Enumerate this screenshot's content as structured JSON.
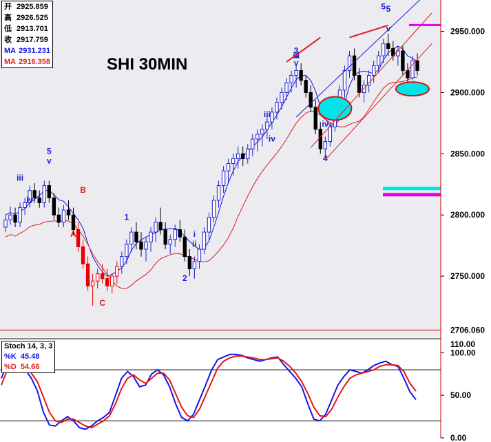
{
  "chart_data": [
    {
      "type": "candlestick",
      "title": "SHI 30MIN",
      "ohlc_box": {
        "open_label": "开",
        "open": "2925.859",
        "high_label": "高",
        "high": "2926.525",
        "low_label": "低",
        "low": "2913.701",
        "close_label": "收",
        "close": "2917.759",
        "ma1_label": "MA",
        "ma1": "2931.231",
        "ma2_label": "MA",
        "ma2": "2916.358"
      },
      "ylim": [
        2700,
        2970
      ],
      "y_ticks": [
        "2950.000",
        "2900.000",
        "2850.000",
        "2800.000",
        "2750.000"
      ],
      "last_price_label": "2706.060",
      "hline_level": 2706,
      "candles": [
        [
          2790,
          2800,
          2786,
          2796
        ],
        [
          2796,
          2807,
          2792,
          2800
        ],
        [
          2800,
          2806,
          2790,
          2794
        ],
        [
          2794,
          2810,
          2790,
          2806
        ],
        [
          2806,
          2814,
          2800,
          2810
        ],
        [
          2810,
          2824,
          2806,
          2820
        ],
        [
          2820,
          2826,
          2810,
          2814
        ],
        [
          2814,
          2820,
          2806,
          2810
        ],
        [
          2810,
          2828,
          2806,
          2824
        ],
        [
          2824,
          2828,
          2810,
          2814
        ],
        [
          2814,
          2818,
          2796,
          2800
        ],
        [
          2800,
          2806,
          2790,
          2794
        ],
        [
          2794,
          2808,
          2790,
          2804
        ],
        [
          2804,
          2812,
          2796,
          2800
        ],
        [
          2800,
          2806,
          2784,
          2788
        ],
        [
          2788,
          2794,
          2770,
          2774
        ],
        [
          2774,
          2780,
          2756,
          2760
        ],
        [
          2760,
          2766,
          2738,
          2742
        ],
        [
          2742,
          2752,
          2726,
          2746
        ],
        [
          2746,
          2756,
          2740,
          2752
        ],
        [
          2752,
          2760,
          2744,
          2748
        ],
        [
          2748,
          2756,
          2738,
          2742
        ],
        [
          2742,
          2752,
          2736,
          2750
        ],
        [
          2750,
          2762,
          2744,
          2758
        ],
        [
          2758,
          2770,
          2752,
          2766
        ],
        [
          2766,
          2780,
          2760,
          2776
        ],
        [
          2776,
          2790,
          2770,
          2786
        ],
        [
          2786,
          2794,
          2772,
          2778
        ],
        [
          2778,
          2786,
          2766,
          2772
        ],
        [
          2772,
          2782,
          2762,
          2778
        ],
        [
          2778,
          2790,
          2770,
          2786
        ],
        [
          2786,
          2798,
          2778,
          2794
        ],
        [
          2794,
          2806,
          2784,
          2788
        ],
        [
          2788,
          2794,
          2772,
          2776
        ],
        [
          2776,
          2784,
          2768,
          2780
        ],
        [
          2780,
          2792,
          2774,
          2788
        ],
        [
          2788,
          2796,
          2778,
          2782
        ],
        [
          2782,
          2788,
          2762,
          2766
        ],
        [
          2766,
          2772,
          2750,
          2756
        ],
        [
          2756,
          2766,
          2748,
          2762
        ],
        [
          2762,
          2776,
          2756,
          2772
        ],
        [
          2772,
          2790,
          2768,
          2786
        ],
        [
          2786,
          2802,
          2780,
          2798
        ],
        [
          2798,
          2816,
          2794,
          2812
        ],
        [
          2812,
          2828,
          2806,
          2824
        ],
        [
          2824,
          2840,
          2818,
          2836
        ],
        [
          2836,
          2846,
          2826,
          2842
        ],
        [
          2842,
          2850,
          2832,
          2846
        ],
        [
          2846,
          2856,
          2838,
          2850
        ],
        [
          2850,
          2856,
          2840,
          2846
        ],
        [
          2846,
          2858,
          2842,
          2854
        ],
        [
          2854,
          2866,
          2848,
          2862
        ],
        [
          2862,
          2870,
          2852,
          2866
        ],
        [
          2866,
          2874,
          2856,
          2870
        ],
        [
          2870,
          2880,
          2862,
          2876
        ],
        [
          2876,
          2888,
          2870,
          2884
        ],
        [
          2884,
          2896,
          2878,
          2892
        ],
        [
          2892,
          2904,
          2886,
          2900
        ],
        [
          2900,
          2912,
          2894,
          2908
        ],
        [
          2908,
          2918,
          2900,
          2914
        ],
        [
          2914,
          2922,
          2904,
          2918
        ],
        [
          2918,
          2924,
          2906,
          2910
        ],
        [
          2910,
          2914,
          2896,
          2900
        ],
        [
          2900,
          2906,
          2884,
          2888
        ],
        [
          2888,
          2894,
          2866,
          2870
        ],
        [
          2870,
          2876,
          2850,
          2854
        ],
        [
          2854,
          2864,
          2846,
          2860
        ],
        [
          2860,
          2876,
          2856,
          2872
        ],
        [
          2872,
          2890,
          2868,
          2886
        ],
        [
          2886,
          2906,
          2880,
          2902
        ],
        [
          2902,
          2922,
          2896,
          2918
        ],
        [
          2918,
          2934,
          2912,
          2930
        ],
        [
          2930,
          2936,
          2910,
          2914
        ],
        [
          2914,
          2920,
          2896,
          2900
        ],
        [
          2900,
          2910,
          2892,
          2906
        ],
        [
          2906,
          2918,
          2900,
          2914
        ],
        [
          2914,
          2926,
          2908,
          2922
        ],
        [
          2922,
          2934,
          2916,
          2930
        ],
        [
          2930,
          2944,
          2924,
          2940
        ],
        [
          2940,
          2948,
          2930,
          2936
        ],
        [
          2936,
          2942,
          2926,
          2930
        ],
        [
          2930,
          2938,
          2922,
          2934
        ],
        [
          2934,
          2938,
          2914,
          2918
        ],
        [
          2918,
          2924,
          2908,
          2912
        ],
        [
          2912,
          2930,
          2910,
          2926
        ],
        [
          2926,
          2932,
          2914,
          2918
        ]
      ],
      "stochastic": {
        "label": "Stoch 14, 3, 3",
        "k_label": "%K",
        "k_value": "45.48",
        "d_label": "%D",
        "d_value": "54.66",
        "ylim": [
          0,
          110
        ],
        "y_ticks": [
          "100.00",
          "50.00",
          "0.00"
        ],
        "top_tick_label": "110.00",
        "levels": [
          80,
          20
        ],
        "k": [
          70,
          88,
          90,
          86,
          80,
          70,
          55,
          30,
          15,
          14,
          20,
          25,
          20,
          12,
          10,
          14,
          20,
          24,
          30,
          50,
          70,
          78,
          72,
          60,
          62,
          75,
          80,
          74,
          60,
          40,
          24,
          20,
          28,
          45,
          62,
          80,
          92,
          95,
          98,
          98,
          97,
          94,
          92,
          90,
          92,
          94,
          95,
          86,
          78,
          70,
          60,
          40,
          22,
          20,
          28,
          45,
          62,
          72,
          80,
          78,
          76,
          80,
          85,
          88,
          90,
          86,
          84,
          70,
          54,
          45
        ],
        "d": [
          62,
          80,
          88,
          88,
          84,
          76,
          66,
          48,
          30,
          20,
          18,
          22,
          22,
          18,
          14,
          12,
          16,
          20,
          26,
          40,
          58,
          70,
          74,
          68,
          64,
          70,
          76,
          76,
          68,
          52,
          36,
          26,
          24,
          34,
          50,
          66,
          82,
          90,
          94,
          96,
          96,
          95,
          94,
          92,
          92,
          93,
          94,
          90,
          84,
          76,
          66,
          52,
          36,
          26,
          25,
          34,
          48,
          60,
          70,
          74,
          76,
          78,
          80,
          84,
          86,
          86,
          85,
          78,
          64,
          55
        ],
        "color_k": "#1414e6",
        "color_d": "#e61414"
      },
      "elliott_labels_blue": [
        "iii",
        "iv",
        "v",
        "5",
        "3",
        "1",
        "i",
        "ii",
        "2",
        "3",
        "v",
        "iii",
        "iv",
        "iii",
        "iv",
        "v",
        "4",
        "5",
        "5"
      ],
      "elliott_labels_red": [
        "A",
        "B",
        "C"
      ],
      "colors": {
        "candle_up": "#1e1ed2",
        "candle_down": "#000000",
        "candle_highlight": "#e60000",
        "ma_fast": "#1414e6",
        "ma_slow": "#dc1e1e",
        "bg_price": "#ebebf0",
        "bg_indicator": "#ffffff",
        "hline": "#cc0000",
        "marker_cyan": "#00e6e6",
        "marker_magenta": "#e600e6",
        "ellipse_stroke": "#d21414"
      }
    }
  ]
}
